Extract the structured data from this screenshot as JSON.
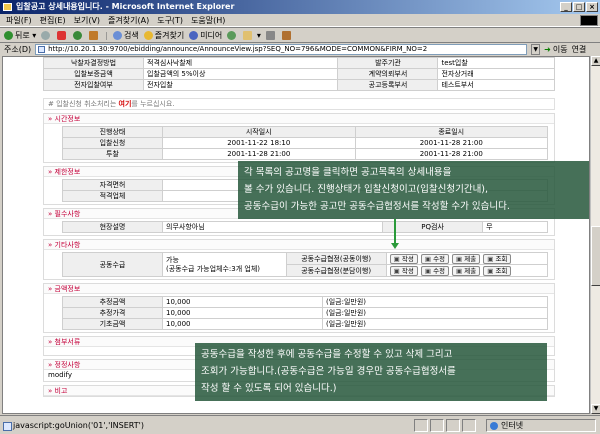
{
  "window": {
    "title": "입찰공고 상세내용입니다. - Microsoft Internet Explorer",
    "min": "_",
    "max": "□",
    "close": "×"
  },
  "menu": [
    "파일(F)",
    "편집(E)",
    "보기(V)",
    "즐겨찾기(A)",
    "도구(T)",
    "도움말(H)"
  ],
  "toolbar": {
    "back": "뒤로",
    "search": "검색",
    "favorites": "즐겨찾기",
    "media": "미디어"
  },
  "address": {
    "label": "주소(D)",
    "url": "http://10.20.1.30:9700/ebidding/announce/AnnounceView.jsp?SEQ_NO=796&MODE=COMMON&FIRM_NO=2",
    "go": "이동",
    "links": "연결"
  },
  "summary": {
    "rows": [
      [
        "낙찰자결정방법",
        "적격심사낙찰제",
        "발주기관",
        "test입찰"
      ],
      [
        "입찰보증금액",
        "입찰금액의 5%이상",
        "계약의뢰부서",
        "전자상거래"
      ],
      [
        "전자입찰여부",
        "전자입찰",
        "공고등록부서",
        "테스트부서"
      ]
    ]
  },
  "notice": {
    "prefix": "# 입찰신청 취소처리는 ",
    "link": "여기",
    "suffix": "를 누르십시요."
  },
  "sections": {
    "schedule": {
      "title": "시간정보",
      "headers": [
        "진행상태",
        "시작일시",
        "종료일시"
      ],
      "rows": [
        [
          "입찰신청",
          "2001-11-22 18:10",
          "2001-11-28 21:00"
        ],
        [
          "투찰",
          "2001-11-28 21:00",
          "2001-11-28 21:00"
        ]
      ]
    },
    "restrictions": {
      "title": "제한정보",
      "rows": [
        [
          "자격면허",
          ""
        ],
        [
          "적격업체",
          ""
        ]
      ]
    },
    "requirements": {
      "title": "필수사항",
      "rows": [
        [
          "현장설명",
          "의무사항아님",
          "PQ검사",
          "무"
        ]
      ]
    },
    "other": {
      "title": "기타사항",
      "consortium_label": "공동수급",
      "consortium_value": "가능",
      "consortium_note": "(공동수급 가능업체수:3개 업체)",
      "rows": [
        {
          "label": "공동수급협정(공동이행)",
          "buttons": [
            "작성",
            "수정",
            "제출",
            "조회"
          ]
        },
        {
          "label": "공동수급협정(분담이행)",
          "buttons": [
            "작성",
            "수정",
            "제출",
            "조회"
          ]
        }
      ]
    },
    "amounts": {
      "title": "금액정보",
      "rows": [
        [
          "추정금액",
          "10,000",
          "(일금:일만원)"
        ],
        [
          "추정가격",
          "10,000",
          "(일금:일만원)"
        ],
        [
          "기초금액",
          "10,000",
          "(일금:일만원)"
        ]
      ]
    },
    "attachments": {
      "title": "첨부서류"
    },
    "revision": {
      "title": "정정사항",
      "text": "modify"
    },
    "remarks": {
      "title": "비고"
    }
  },
  "callouts": {
    "first": [
      "각 목록의 공고명을 클릭하면 공고목록의 상세내용을",
      "볼 수가 있습니다. 진행상태가 입찰신청이고(입찰신청기간내),",
      "공동수급이 가능한 공고만 공동수급협정서를 작성할 수가 있습니다."
    ],
    "second": [
      "공동수급을 작성한 후에 공동수급을 수정할 수 있고 삭제 그리고",
      "조회가 가능합니다.(공동수급은 가능일 경우만 공동수급협정서를",
      "작성 할 수 있도록 되어 있습니다.)"
    ]
  },
  "status": {
    "text": "javascript:goUnion('01','INSERT')",
    "zone": "인터넷"
  }
}
